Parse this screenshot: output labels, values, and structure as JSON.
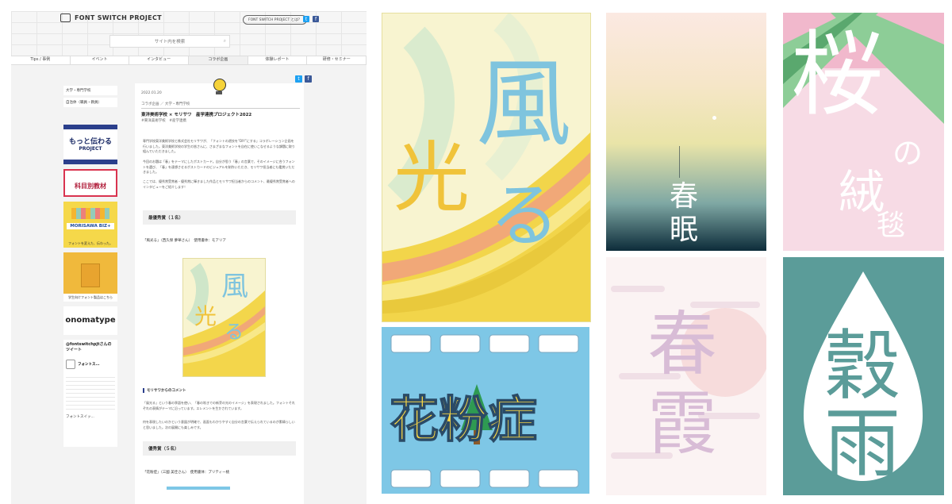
{
  "site": {
    "logo": "FONT SWITCH PROJECT",
    "header_pill": "FONT SWITCH PROJECT とは？",
    "search_placeholder": "サイト内を検索",
    "nav": [
      "Tips / 事例",
      "イベント",
      "インタビュー",
      "コラボ企画",
      "体験レポート",
      "研修・セミナー"
    ],
    "active_nav_index": 3,
    "sidebar_links": [
      "大学・専門学校",
      "自治体（職員・教員）"
    ],
    "banners": [
      {
        "caption": "もっと伝わる",
        "sub": "PROJECT"
      },
      {
        "caption": "科目別教材",
        "sub": ""
      },
      {
        "caption": "MORISAWA BIZ+",
        "sub": "フォントを変えた、伝わった。"
      },
      {
        "caption": "学生向けフォント製品はこちら",
        "sub": ""
      },
      {
        "caption": "onomatype",
        "sub": ""
      }
    ],
    "tweets_title": "@fontswitchpjtさんのツイート",
    "tweet_author": "フォントス...",
    "tweet_footer": "フォントスイッ...",
    "article": {
      "date": "2022.01.20",
      "breadcrumb": "コラボ企画 ／ 大学・専門学校",
      "title": "東洋美術学校 × モリサワ　産学連携プロジェクト2022",
      "tags": "#東洋美術学校　#産学連携",
      "intro1": "専門学校東洋美術学校と株式会社モリサワが、「フォントの遊技を“DIY”にする」コラボレーション企画を行いました。東洋美術学校の学生の皆さんに、さまざまなフォントを自在に使いこなせるような課題に取り組んでいただきました。",
      "intro2": "今回のお題は「春」をテーマにしたポストカード。自分が思う「春」の言葉で、そのイメージに合うフォントを選び、「春」を連想させるポストカードのビジュアルを制作いただき、モリサワ担当者にも鑑賞いただきました。",
      "intro3": "ここでは、優秀賞受賞者・優秀賞に輝きました作品とモリサワ担当者からのコメント、最優秀賞受賞者へのインタビューをご紹介します！",
      "section1": "最優秀賞（１名）",
      "work1": "「風光る」（西久保 夢華さん）　使用書体：モアリア",
      "comment_head": "モリサワからのコメント",
      "comment1": "「風光る」という春の季語を使い、「春の吹きでの新芽の光のイメージ」を表現されました。フォントそれぞれの表情がテーマに沿っています。エレメントを生かされています。",
      "comment2": "何を表現したいのかという意図が明確で、画面もわかりやすく自分の言葉で伝えられているのが素晴らしいと思いました。次の展開にも楽しみです。",
      "section2": "優秀賞（５名）",
      "work2": "「花粉症」（三國 美佳さん）　使用書体：プリティー桃"
    }
  },
  "posters": {
    "kaze": {
      "chars": [
        "風",
        "光",
        "る"
      ],
      "colors": {
        "bg": "#f8f4d0",
        "yellow": "#f2d54a",
        "blue": "#7fc4de",
        "orange": "#f1a878"
      }
    },
    "kafunsho": {
      "text": "花粉症",
      "colors": {
        "bg": "#7ec7e6",
        "yellow": "#f7d545"
      }
    },
    "shunmin": {
      "chars": [
        "春",
        "眠"
      ],
      "colors": {
        "top": "#fbe9e2",
        "bottom": "#0d2c3a"
      }
    },
    "sakura": {
      "chars": [
        "桜",
        "の",
        "絨",
        "毯"
      ],
      "colors": {
        "pink": "#f1b8cc",
        "green": "#7fc48f"
      }
    },
    "harugasumi": {
      "chars": [
        "春",
        "霞"
      ],
      "colors": {
        "bg": "#fbf3f3",
        "text": "#d8bcd6"
      }
    },
    "kokuu": {
      "chars": [
        "穀",
        "雨"
      ],
      "colors": {
        "bg": "#5b9c99",
        "drop": "#ffffff"
      }
    }
  }
}
